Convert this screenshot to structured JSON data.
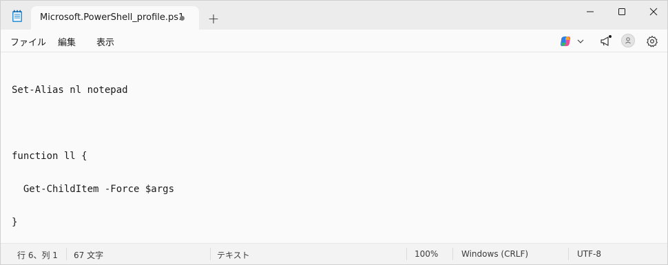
{
  "window": {
    "tab_title": "Microsoft.PowerShell_profile.ps1",
    "new_tab_label": "+",
    "unsaved_indicator": "unsaved-dot"
  },
  "menu": {
    "file": "ファイル",
    "edit": "編集",
    "view": "表示"
  },
  "toolbar": {
    "copilot_icon": "copilot-icon",
    "announcements_icon": "megaphone-icon",
    "account_icon": "person-icon",
    "settings_icon": "gear-icon"
  },
  "editor": {
    "lines": [
      "Set-Alias nl notepad",
      "",
      "function ll {",
      "  Get-ChildItem -Force $args",
      "}"
    ]
  },
  "status": {
    "position": "行 6、列 1",
    "char_count": "67 文字",
    "format": "テキスト",
    "zoom": "100%",
    "line_ending": "Windows (CRLF)",
    "encoding": "UTF-8"
  },
  "colors": {
    "titlebar_bg": "#ececec",
    "editor_bg": "#fafafa",
    "statusbar_bg": "#f3f3f3"
  }
}
